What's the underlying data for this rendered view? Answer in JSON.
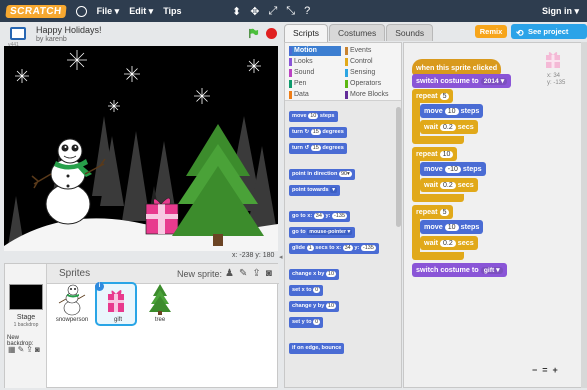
{
  "menubar": {
    "logo": "SCRATCH",
    "menus": [
      "File ▾",
      "Edit ▾",
      "Tips"
    ],
    "signin": "Sign in ▾"
  },
  "project": {
    "title": "Happy Holidays!",
    "author": "by karenb",
    "version": "v441"
  },
  "stage": {
    "coords": "x: -238  y: 180"
  },
  "sprites": {
    "title": "Sprites",
    "new_sprite_label": "New sprite:",
    "stage_label": "Stage",
    "backdrops_label": "1 backdrop",
    "new_backdrop_label": "New backdrop:",
    "items": [
      {
        "name": "snowperson",
        "selected": false
      },
      {
        "name": "gift",
        "selected": true
      },
      {
        "name": "tree",
        "selected": false
      }
    ]
  },
  "tabs": [
    "Scripts",
    "Costumes",
    "Sounds"
  ],
  "buttons": {
    "remix": "Remix",
    "see_project_page": "See project page"
  },
  "categories": [
    {
      "label": "Motion",
      "color": "#4a6cd4",
      "active": true
    },
    {
      "label": "Events",
      "color": "#c88330"
    },
    {
      "label": "Looks",
      "color": "#8a55d7"
    },
    {
      "label": "Control",
      "color": "#e1a91a"
    },
    {
      "label": "Sound",
      "color": "#bb42c3"
    },
    {
      "label": "Sensing",
      "color": "#2ca5e2"
    },
    {
      "label": "Pen",
      "color": "#0e9a6c"
    },
    {
      "label": "Operators",
      "color": "#5cb712"
    },
    {
      "label": "Data",
      "color": "#ee7d16"
    },
    {
      "label": "More Blocks",
      "color": "#632d99"
    }
  ],
  "palette": {
    "move_prefix": "move",
    "move_val": "10",
    "move_suffix": "steps",
    "turn_cw_prefix": "turn",
    "turn_cw_val": "15",
    "turn_cw_suffix": "degrees",
    "turn_ccw_prefix": "turn",
    "turn_ccw_val": "15",
    "turn_ccw_suffix": "degrees",
    "point_dir_prefix": "point in direction",
    "point_dir_val": "90▾",
    "point_towards_prefix": "point towards",
    "point_towards_val": "▾",
    "goto_xy_prefix": "go to x:",
    "goto_x": "34",
    "goto_xy_mid": "y:",
    "goto_y": "-135",
    "goto_prefix": "go to",
    "goto_val": "mouse-pointer ▾",
    "glide_prefix": "glide",
    "glide_secs": "1",
    "glide_mid1": "secs to x:",
    "glide_x": "34",
    "glide_mid2": "y:",
    "glide_y": "-135",
    "change_x_prefix": "change x by",
    "change_x_val": "10",
    "set_x_prefix": "set x to",
    "set_x_val": "0",
    "change_y_prefix": "change y by",
    "change_y_val": "10",
    "set_y_prefix": "set y to",
    "set_y_val": "0",
    "bounce": "if on edge, bounce"
  },
  "script": {
    "hat": "when this sprite clicked",
    "switch1_prefix": "switch costume to",
    "switch1_val": "2014 ▾",
    "repeat1_prefix": "repeat",
    "repeat1_val": "5",
    "move1_prefix": "move",
    "move1_val": "10",
    "move1_suffix": "steps",
    "wait1_prefix": "wait",
    "wait1_val": "0.2",
    "wait1_suffix": "secs",
    "repeat2_prefix": "repeat",
    "repeat2_val": "10",
    "move2_prefix": "move",
    "move2_val": "-10",
    "move2_suffix": "steps",
    "wait2_prefix": "wait",
    "wait2_val": "0.2",
    "wait2_suffix": "secs",
    "repeat3_prefix": "repeat",
    "repeat3_val": "5",
    "move3_prefix": "move",
    "move3_val": "10",
    "move3_suffix": "steps",
    "wait3_prefix": "wait",
    "wait3_val": "0.2",
    "wait3_suffix": "secs",
    "switch2_prefix": "switch costume to",
    "switch2_val": "gift ▾"
  },
  "sprite_info": {
    "x": "x: 34",
    "y": "y: -135"
  },
  "zoom": {
    "out": "−",
    "reset": "=",
    "in": "+"
  }
}
